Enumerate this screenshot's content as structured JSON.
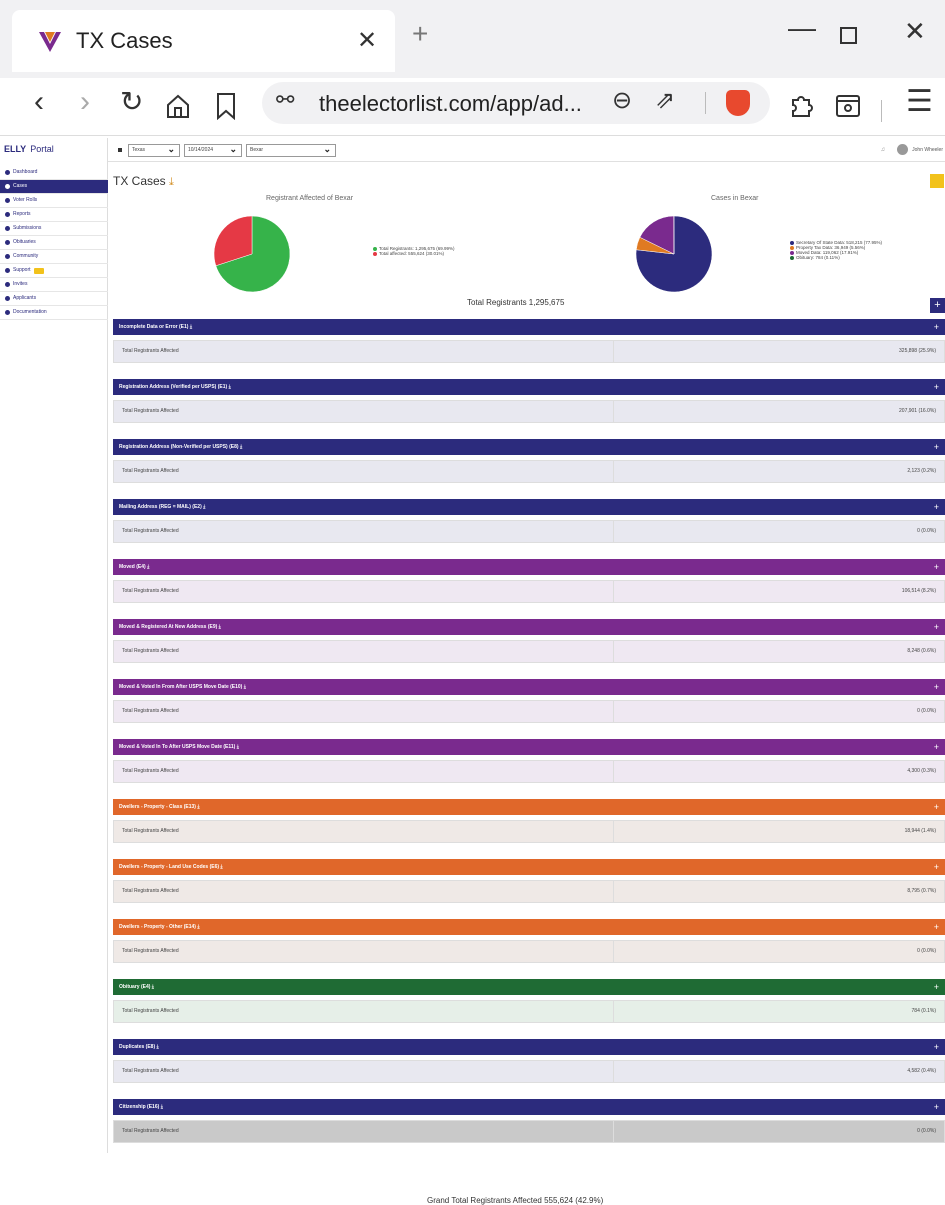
{
  "browser": {
    "tab_title": "TX Cases",
    "url": "theelectorlist.com/app/ad..."
  },
  "sidebar": {
    "brand": "ELLY",
    "brand_suffix": "Portal",
    "items": [
      {
        "label": "Dashboard"
      },
      {
        "label": "Cases"
      },
      {
        "label": "Voter Rolls"
      },
      {
        "label": "Reports"
      },
      {
        "label": "Submissions"
      },
      {
        "label": "Obituaries"
      },
      {
        "label": "Community"
      },
      {
        "label": "Support"
      },
      {
        "label": "Invites"
      },
      {
        "label": "Applicants"
      },
      {
        "label": "Documentation"
      }
    ]
  },
  "filters": {
    "state": "Texas",
    "date": "10/14/2024",
    "county": "Bexar",
    "user": "John Wheeler"
  },
  "page": {
    "title": "TX Cases",
    "chart1_title": "Registrant Affected of Bexar",
    "chart2_title": "Cases in Bexar",
    "total_registrants": "Total Registrants 1,295,675",
    "grand_total": "Grand Total Registrants Affected 555,624 (42.9%)"
  },
  "chart_data": [
    {
      "type": "pie",
      "title": "Registrant Affected of Bexar",
      "labels": [
        "Total Registrants: 1,295,675 (69.99%)",
        "Total affected: 555,624 (30.01%)"
      ],
      "values": [
        69.99,
        30.01
      ],
      "colors": [
        "#36b34a",
        "#e53945"
      ]
    },
    {
      "type": "pie",
      "title": "Cases in Bexar",
      "labels": [
        "Secretary Of State Data: 518,215 (77.95%)",
        "Property Tax Data: 36,949 (5.56%)",
        "Moved Data: 119,062 (17.91%)",
        "Obituary: 784 (0.11%)"
      ],
      "values": [
        77.95,
        5.56,
        17.91,
        0.11
      ],
      "colors": [
        "#2c2b7d",
        "#e07a22",
        "#7a2a8e",
        "#1f6b34"
      ]
    }
  ],
  "sections": [
    {
      "title": "Incomplete Data or Error (E1)",
      "color": "#2c2b7d",
      "row_label": "Total Registrants Affected",
      "value": "325,898 (25.9%)"
    },
    {
      "title": "Registration Address (Verified per USPS) (E1)",
      "color": "#2c2b7d",
      "row_label": "Total Registrants Affected",
      "value": "207,901 (16.0%)"
    },
    {
      "title": "Registration Address (Non-Verified per USPS) (E8)",
      "color": "#2c2b7d",
      "row_label": "Total Registrants Affected",
      "value": "2,123 (0.2%)"
    },
    {
      "title": "Mailing Address (REG = MAIL) (E2)",
      "color": "#2c2b7d",
      "row_label": "Total Registrants Affected",
      "value": "0 (0.0%)"
    },
    {
      "title": "Moved (E4)",
      "color": "#7a2a8e",
      "row_label": "Total Registrants Affected",
      "value": "106,514 (8.2%)"
    },
    {
      "title": "Moved & Registered At New Address (E9)",
      "color": "#7a2a8e",
      "row_label": "Total Registrants Affected",
      "value": "8,248 (0.6%)"
    },
    {
      "title": "Moved & Voted In From After USPS Move Date (E10)",
      "color": "#7a2a8e",
      "row_label": "Total Registrants Affected",
      "value": "0 (0.0%)"
    },
    {
      "title": "Moved & Voted In To After USPS Move Date (E11)",
      "color": "#7a2a8e",
      "row_label": "Total Registrants Affected",
      "value": "4,300 (0.3%)"
    },
    {
      "title": "Dwellers - Property - Class (E13)",
      "color": "#e0672a",
      "row_label": "Total Registrants Affected",
      "value": "18,944 (1.4%)"
    },
    {
      "title": "Dwellers - Property - Land Use Codes (E6)",
      "color": "#e0672a",
      "row_label": "Total Registrants Affected",
      "value": "8,795 (0.7%)"
    },
    {
      "title": "Dwellers - Property - Other (E14)",
      "color": "#e0672a",
      "row_label": "Total Registrants Affected",
      "value": "0 (0.0%)"
    },
    {
      "title": "Obituary (E4)",
      "color": "#1f6b34",
      "row_label": "Total Registrants Affected",
      "value": "784 (0.1%)"
    },
    {
      "title": "Duplicates (E8)",
      "color": "#2c2b7d",
      "row_label": "Total Registrants Affected",
      "value": "4,582 (0.4%)"
    },
    {
      "title": "Citizenship (E16)",
      "color": "#2c2b7d",
      "row_label": "Total Registrants Affected",
      "value": "0 (0.0%)"
    }
  ]
}
